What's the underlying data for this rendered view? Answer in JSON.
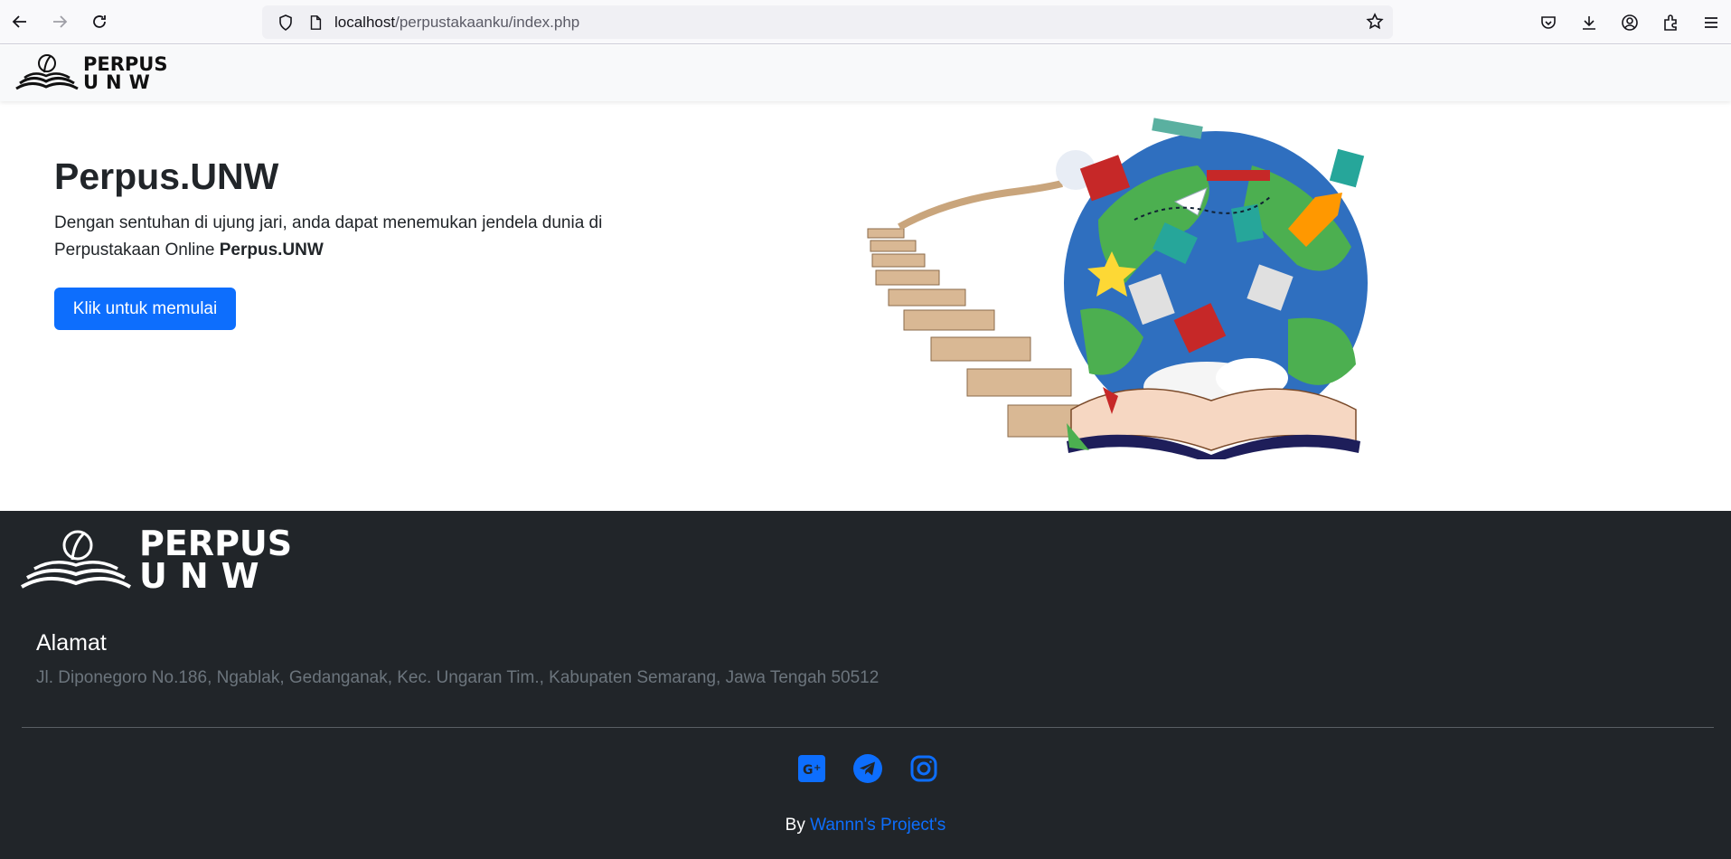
{
  "browser": {
    "url_host": "localhost",
    "url_path": "/perpustakaanku/index.php"
  },
  "navbar": {
    "logo_line1": "PERPUS",
    "logo_line2": "UNW"
  },
  "hero": {
    "title": "Perpus.UNW",
    "description": "Dengan sentuhan di ujung jari, anda dapat menemukan jendela dunia di Perpustakaan Online",
    "description_bold": "Perpus.UNW",
    "cta_label": "Klik untuk memulai"
  },
  "footer": {
    "logo_line1": "PERPUS",
    "logo_line2": "UNW",
    "address_title": "Alamat",
    "address_text": "Jl. Diponegoro No.186, Ngablak, Gedanganak, Kec. Ungaran Tim., Kabupaten Semarang, Jawa Tengah 50512",
    "socials": [
      "google-plus-icon",
      "telegram-icon",
      "instagram-icon"
    ],
    "credit_prefix": "By",
    "credit_link": "Wannn's Project's"
  },
  "colors": {
    "primary": "#0d6efd",
    "footer_bg": "#212529",
    "muted": "#6c757d"
  }
}
